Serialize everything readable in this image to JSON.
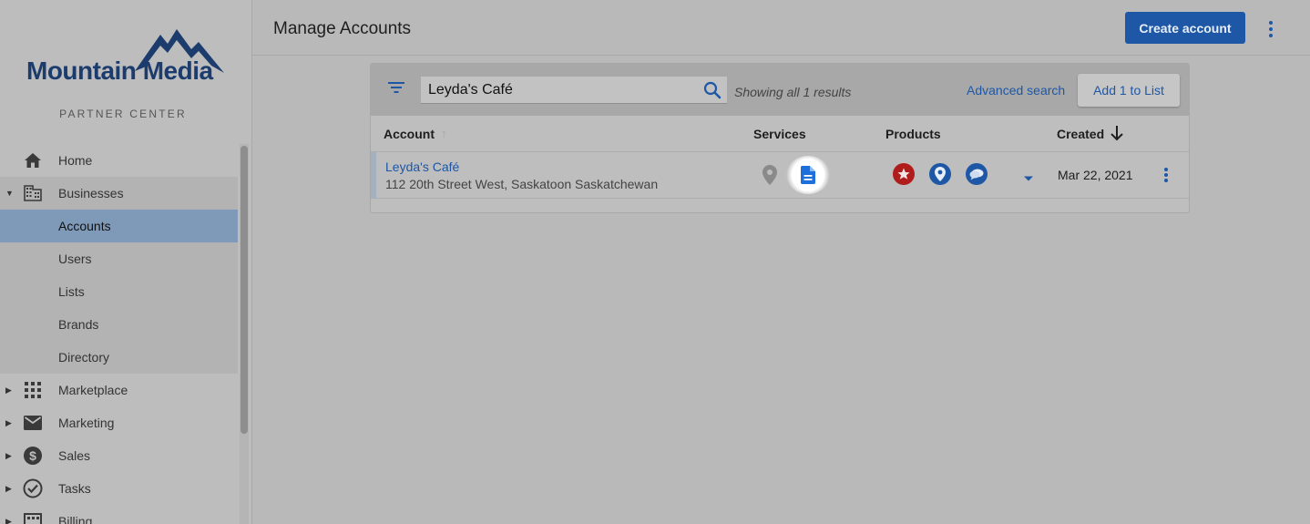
{
  "brand": {
    "name": "Mountain Media",
    "subtitle": "PARTNER CENTER",
    "color": "#1c3c6e"
  },
  "sidebar": {
    "items": [
      {
        "label": "Home",
        "icon": "home-icon"
      },
      {
        "label": "Businesses",
        "icon": "building-icon",
        "expanded": true
      },
      {
        "label": "Accounts",
        "active": true
      },
      {
        "label": "Users"
      },
      {
        "label": "Lists"
      },
      {
        "label": "Brands"
      },
      {
        "label": "Directory"
      },
      {
        "label": "Marketplace",
        "icon": "apps-grid-icon"
      },
      {
        "label": "Marketing",
        "icon": "mail-icon"
      },
      {
        "label": "Sales",
        "icon": "dollar-icon"
      },
      {
        "label": "Tasks",
        "icon": "check-circle-icon"
      },
      {
        "label": "Billing",
        "icon": "billing-icon"
      }
    ]
  },
  "header": {
    "title": "Manage Accounts",
    "create_label": "Create account",
    "accent": "#1d57a6"
  },
  "toolbar": {
    "search_value": "Leyda's Café",
    "showing": "Showing all 1 results",
    "advanced": "Advanced search",
    "add_to_list": "Add 1 to List"
  },
  "table": {
    "columns": [
      "Account",
      "Services",
      "Products",
      "Created"
    ],
    "rows": [
      {
        "name": "Leyda's Café",
        "address": "112 20th Street West, Saskatoon Saskatchewan",
        "services": [
          "location-pin-icon",
          "document-icon"
        ],
        "products": [
          {
            "icon": "star-badge-icon",
            "color": "#b01c1c"
          },
          {
            "icon": "map-pin-badge-icon",
            "color": "#1d57a6"
          },
          {
            "icon": "chat-badge-icon",
            "color": "#1d57a6"
          }
        ],
        "created": "Mar 22, 2021"
      }
    ]
  }
}
